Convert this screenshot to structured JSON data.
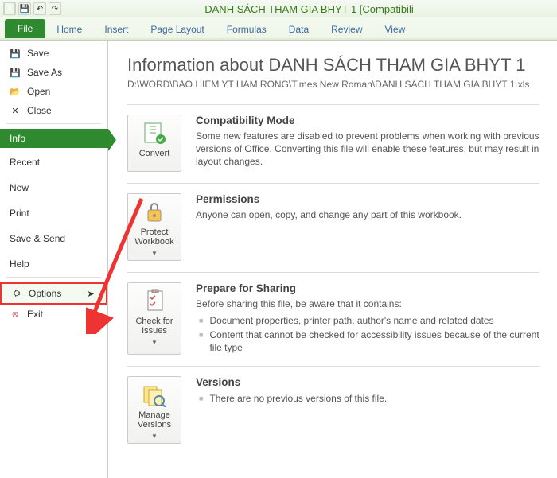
{
  "window": {
    "title": "DANH SÁCH THAM GIA BHYT 1  [Compatibili"
  },
  "tabs": {
    "file": "File",
    "items": [
      "Home",
      "Insert",
      "Page Layout",
      "Formulas",
      "Data",
      "Review",
      "View"
    ]
  },
  "sidebar": {
    "top": [
      {
        "label": "Save",
        "icon": "save-icon"
      },
      {
        "label": "Save As",
        "icon": "save-as-icon"
      },
      {
        "label": "Open",
        "icon": "open-icon"
      },
      {
        "label": "Close",
        "icon": "close-doc-icon"
      }
    ],
    "info": "Info",
    "mid": [
      "Recent",
      "New",
      "Print",
      "Save & Send",
      "Help"
    ],
    "bottom": [
      {
        "label": "Options",
        "icon": "options-icon"
      },
      {
        "label": "Exit",
        "icon": "exit-icon"
      }
    ]
  },
  "page": {
    "title": "Information about DANH SÁCH THAM GIA BHYT 1",
    "path": "D:\\WORD\\BAO HIEM YT HAM RONG\\Times New Roman\\DANH SÁCH THAM GIA BHYT 1.xls"
  },
  "tiles": {
    "convert": "Convert",
    "protect": "Protect Workbook",
    "check": "Check for Issues",
    "manage": "Manage Versions"
  },
  "sections": {
    "compat": {
      "h": "Compatibility Mode",
      "p": "Some new features are disabled to prevent problems when working with previous versions of Office. Converting this file will enable these features, but may result in layout changes."
    },
    "perm": {
      "h": "Permissions",
      "p": "Anyone can open, copy, and change any part of this workbook."
    },
    "share": {
      "h": "Prepare for Sharing",
      "p": "Before sharing this file, be aware that it contains:",
      "li1": "Document properties, printer path, author's name and related dates",
      "li2": "Content that cannot be checked for accessibility issues because of the current file type"
    },
    "ver": {
      "h": "Versions",
      "li1": "There are no previous versions of this file."
    }
  }
}
